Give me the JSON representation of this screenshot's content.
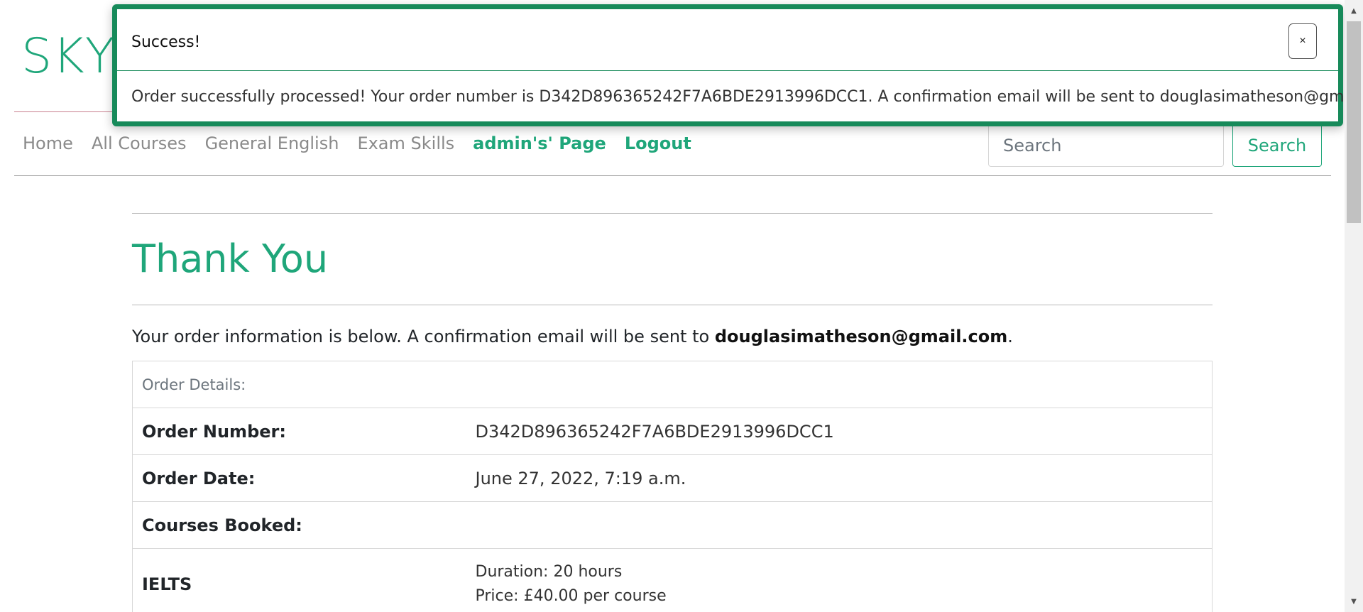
{
  "brand": {
    "name": "SKY"
  },
  "nav": {
    "links": [
      {
        "label": "Home"
      },
      {
        "label": "All Courses"
      },
      {
        "label": "General English"
      },
      {
        "label": "Exam Skills"
      },
      {
        "label": "admin's' Page"
      },
      {
        "label": "Logout"
      }
    ],
    "search_placeholder": "Search",
    "search_button": "Search"
  },
  "main": {
    "title": "Thank You",
    "intro_text": "Your order information is below. A confirmation email will be sent to ",
    "intro_email": "douglasimatheson@gmail.com",
    "intro_end": ".",
    "table": {
      "caption": "Order Details:",
      "rows": [
        {
          "label": "Order Number:",
          "value": "D342D896365242F7A6BDE2913996DCC1"
        },
        {
          "label": "Order Date:",
          "value": "June 27, 2022, 7:19 a.m."
        },
        {
          "label": "Courses Booked:",
          "value": ""
        }
      ],
      "course": {
        "name": "IELTS",
        "duration": "Duration: 20 hours",
        "price": "Price: £40.00 per course"
      }
    }
  },
  "toast": {
    "title": "Success!",
    "close": "×",
    "message": "Order successfully processed! Your order number is D342D896365242F7A6BDE2913996DCC1. A confirmation email will be sent to douglasimatheson@gmail.com."
  },
  "colors": {
    "accent": "#1fa67a",
    "toast_border": "#178a5a"
  }
}
